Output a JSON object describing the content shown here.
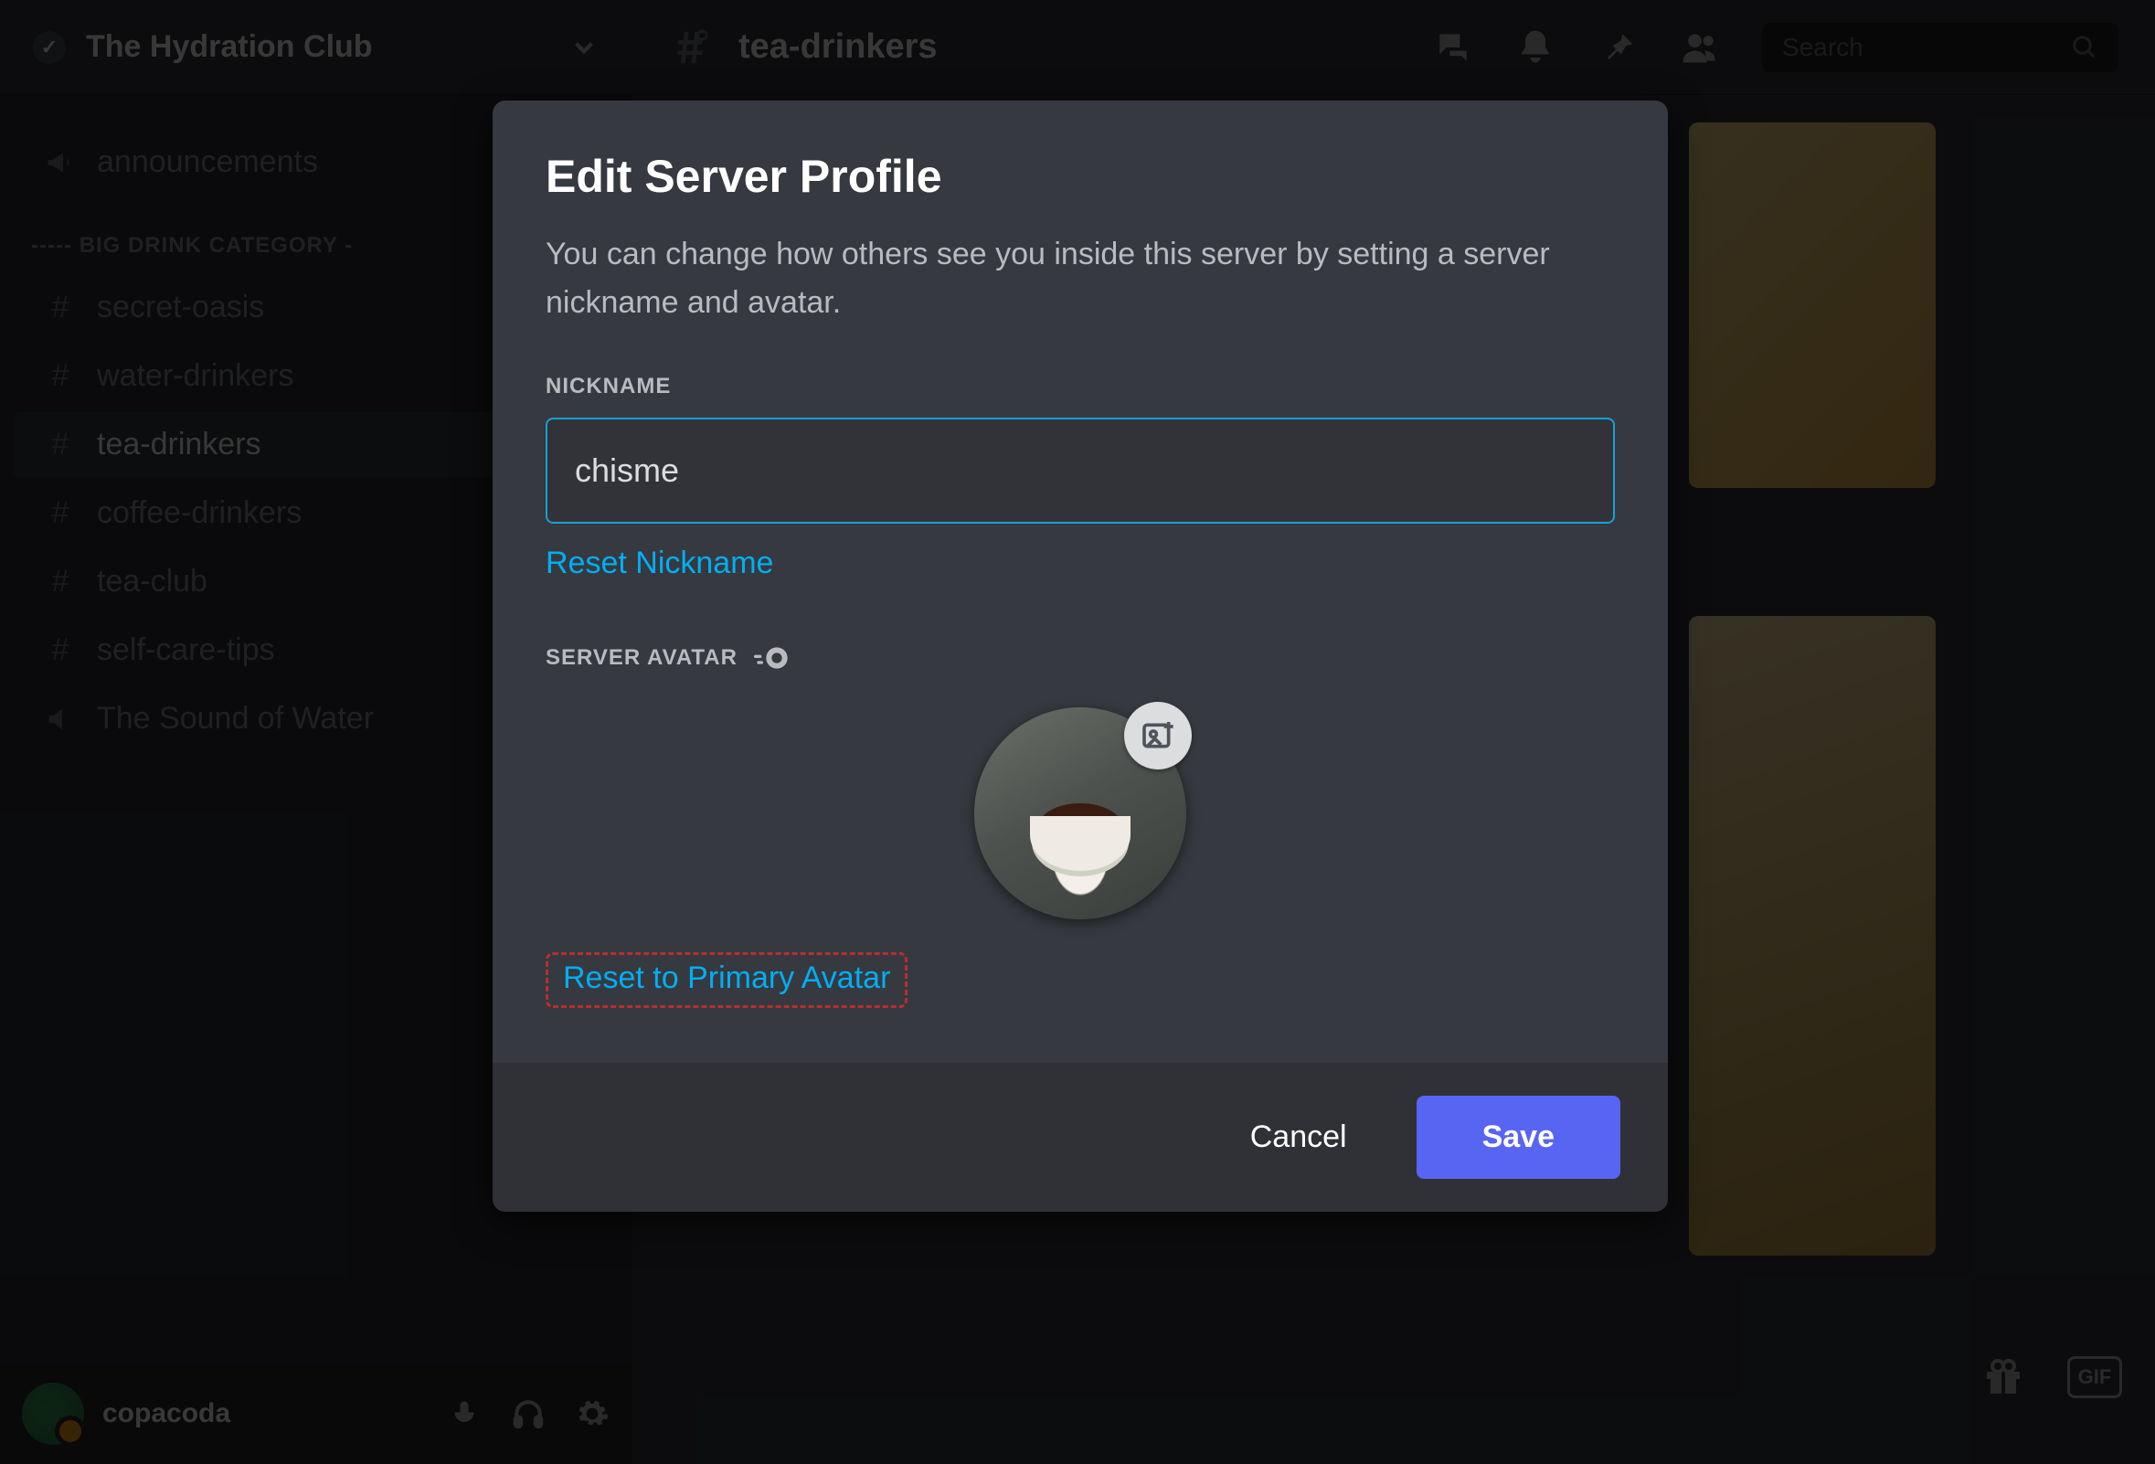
{
  "server": {
    "name": "The Hydration Club"
  },
  "channel_header": {
    "name": "tea-drinkers"
  },
  "search": {
    "placeholder": "Search"
  },
  "sidebar": {
    "announcements": "announcements",
    "category": "----- BIG DRINK CATEGORY -",
    "items": [
      {
        "label": "secret-oasis"
      },
      {
        "label": "water-drinkers"
      },
      {
        "label": "tea-drinkers"
      },
      {
        "label": "coffee-drinkers"
      },
      {
        "label": "tea-club"
      },
      {
        "label": "self-care-tips"
      },
      {
        "label": "The Sound of Water"
      }
    ]
  },
  "user": {
    "name": "copacoda"
  },
  "gif_label": "GIF",
  "modal": {
    "title": "Edit Server Profile",
    "description": "You can change how others see you inside this server by setting a server nickname and avatar.",
    "nickname_label": "NICKNAME",
    "nickname_value": "chisme",
    "reset_nickname": "Reset Nickname",
    "server_avatar_label": "SERVER AVATAR",
    "reset_avatar": "Reset to Primary Avatar",
    "cancel": "Cancel",
    "save": "Save"
  }
}
